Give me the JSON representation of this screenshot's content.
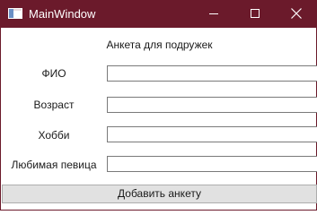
{
  "window": {
    "title": "MainWindow",
    "controls": {
      "minimize": "minimize-icon",
      "maximize": "maximize-icon",
      "close": "close-icon"
    },
    "title_bar_color": "#6b1a2b"
  },
  "form": {
    "heading": "Анкета для подружек",
    "fields": [
      {
        "label": "ФИО",
        "value": ""
      },
      {
        "label": "Возраст",
        "value": ""
      },
      {
        "label": "Хобби",
        "value": ""
      },
      {
        "label": "Любимая певица",
        "value": ""
      }
    ],
    "submit_label": "Добавить анкету"
  }
}
